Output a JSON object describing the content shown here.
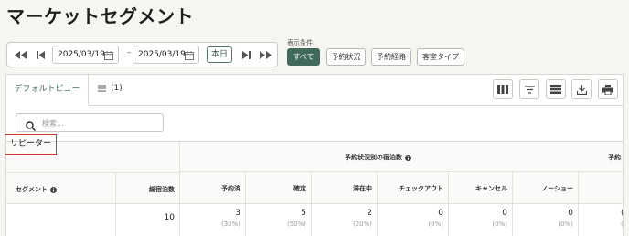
{
  "page": {
    "title": "マーケットセグメント"
  },
  "date_nav": {
    "start_date": "2025/03/19",
    "separator": "–",
    "end_date": "2025/03/19",
    "today_label": "本日"
  },
  "filters": {
    "label": "表示条件:",
    "options": [
      {
        "label": "すべて",
        "active": true
      },
      {
        "label": "予約状況",
        "active": false
      },
      {
        "label": "予約経路",
        "active": false
      },
      {
        "label": "客室タイプ",
        "active": false
      }
    ]
  },
  "view": {
    "default_tab": "デフォルトビュー",
    "filter_count": "(1)",
    "search_placeholder": "検索..."
  },
  "table": {
    "group_header": "予約状況別の宿泊数",
    "group_header_2": "予約",
    "segment_header": "セグメント",
    "total_header": "総宿泊数",
    "columns": [
      "予約済",
      "確定",
      "滞在中",
      "チェックアウト",
      "キャンセル",
      "ノーショー"
    ],
    "row": {
      "segment": "リピーター",
      "total": "10",
      "values": [
        "3",
        "5",
        "2",
        "0",
        "0",
        "0"
      ],
      "percents": [
        "(30%)",
        "(50%)",
        "(20%)",
        "(0%)",
        "(0%)",
        "(0%)"
      ],
      "trailing_value": "(",
      "trailing_pct": "("
    }
  },
  "colors": {
    "accent": "#3f6a5c",
    "highlight": "#d9362b"
  }
}
